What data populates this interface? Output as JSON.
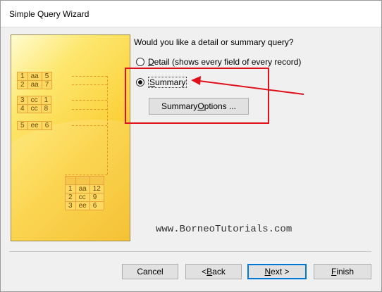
{
  "window": {
    "title": "Simple Query Wizard"
  },
  "question": "Would you like a detail or summary query?",
  "options": [
    {
      "label_pre": "",
      "accel": "D",
      "label_post": "etail (shows every field of every record)",
      "selected": false
    },
    {
      "label_pre": "",
      "accel": "S",
      "label_post": "ummary",
      "selected": true
    }
  ],
  "summary_options_button": {
    "label_pre": "Summary ",
    "accel": "O",
    "label_post": "ptions ..."
  },
  "illustration": {
    "source_rows": [
      [
        "1",
        "aa",
        "5"
      ],
      [
        "2",
        "aa",
        "7"
      ],
      [
        "3",
        "cc",
        "1"
      ],
      [
        "4",
        "cc",
        "8"
      ],
      [
        "5",
        "ee",
        "6"
      ]
    ],
    "summary_rows": [
      [
        "1",
        "aa",
        "12"
      ],
      [
        "2",
        "cc",
        "9"
      ],
      [
        "3",
        "ee",
        "6"
      ]
    ]
  },
  "watermark": "www.BorneoTutorials.com",
  "buttons": {
    "cancel": "Cancel",
    "back_pre": "< ",
    "back_accel": "B",
    "back_post": "ack",
    "next_pre": "",
    "next_accel": "N",
    "next_post": "ext >",
    "finish_pre": "",
    "finish_accel": "F",
    "finish_post": "inish"
  },
  "annotation_color": "#e0101a"
}
